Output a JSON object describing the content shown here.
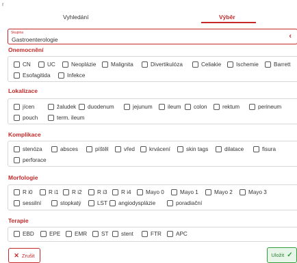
{
  "corner_mark": "r",
  "tabs": {
    "search": "Vyhledání",
    "select": "Výběr"
  },
  "group": {
    "caption": "Skupina",
    "value": "Gastroenterologie",
    "chevron": "‹"
  },
  "sections": {
    "onemocneni": {
      "title": "Onemocnění",
      "items": [
        "CN",
        "UC",
        "Neoplázie",
        "Malignita",
        "Divertikulóza",
        "Celiakie",
        "Ischemie",
        "Barrett",
        "Esofagitida",
        "Infekce"
      ]
    },
    "lokalizace": {
      "title": "Lokalizace",
      "items": [
        "jícen",
        "žaludek",
        "duodenum",
        "jejunum",
        "ileum",
        "colon",
        "rektum",
        "perineum",
        "pouch",
        "term. ileum"
      ]
    },
    "komplikace": {
      "title": "Komplikace",
      "items": [
        "stenóza",
        "absces",
        "píštěl",
        "vřed",
        "krvácení",
        "skin tags",
        "dilatace",
        "fisura",
        "perforace"
      ]
    },
    "morfologie": {
      "title": "Morfologie",
      "items": [
        "R i0",
        "R i1",
        "R i2",
        "R i3",
        "R i4",
        "Mayo 0",
        "Mayo 1",
        "Mayo 2",
        "Mayo 3",
        "sessilní",
        "stopkatý",
        "LST",
        "angiodysplázie",
        "poradiační"
      ]
    },
    "terapie": {
      "title": "Terapie",
      "items": [
        "EBD",
        "EPE",
        "EMR",
        "ST",
        "stent",
        "FTR",
        "APC"
      ]
    }
  },
  "buttons": {
    "cancel": "Zrušit",
    "cancel_icon": "✕",
    "save": "Uložit",
    "save_icon": "✓"
  }
}
